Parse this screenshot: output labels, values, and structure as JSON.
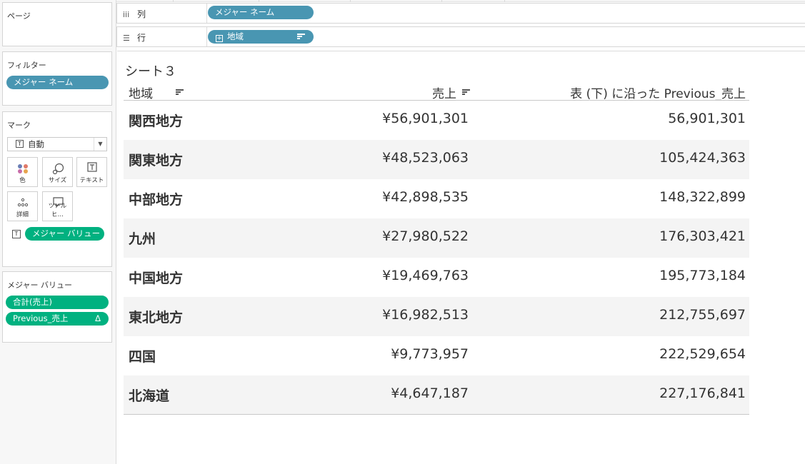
{
  "left_panel": {
    "pages": {
      "title": "ページ"
    },
    "filters": {
      "title": "フィルター",
      "pills": [
        "メジャー ネーム"
      ]
    },
    "marks": {
      "title": "マーク",
      "type": "自動",
      "buttons": {
        "color": "色",
        "size": "サイズ",
        "text": "テキスト",
        "detail": "詳細",
        "tooltip": "ツールヒ…"
      },
      "text_pill": "メジャー バリュー"
    },
    "measure_values": {
      "title": "メジャー バリュー",
      "pills": [
        "合計(売上)",
        "Previous_売上"
      ],
      "delta": "Δ"
    }
  },
  "shelves": {
    "columns": {
      "label": "列",
      "pill": "メジャー ネーム"
    },
    "rows": {
      "label": "行",
      "pill": "地域"
    }
  },
  "sheet": {
    "title": "シート３",
    "headers": {
      "region": "地域",
      "sales": "売上",
      "previous": "表 (下) に沿った Previous_売上"
    },
    "rows": [
      {
        "region": "関西地方",
        "sales": "¥56,901,301",
        "previous": "56,901,301"
      },
      {
        "region": "関東地方",
        "sales": "¥48,523,063",
        "previous": "105,424,363"
      },
      {
        "region": "中部地方",
        "sales": "¥42,898,535",
        "previous": "148,322,899"
      },
      {
        "region": "九州",
        "sales": "¥27,980,522",
        "previous": "176,303,421"
      },
      {
        "region": "中国地方",
        "sales": "¥19,469,763",
        "previous": "195,773,184"
      },
      {
        "region": "東北地方",
        "sales": "¥16,982,513",
        "previous": "212,755,697"
      },
      {
        "region": "四国",
        "sales": "¥9,773,957",
        "previous": "222,529,654"
      },
      {
        "region": "北海道",
        "sales": "¥4,647,187",
        "previous": "227,176,841"
      }
    ]
  },
  "colors": {
    "dimension_pill": "#4996b2",
    "measure_pill": "#00b180",
    "alt_row": "#f4f4f4"
  }
}
